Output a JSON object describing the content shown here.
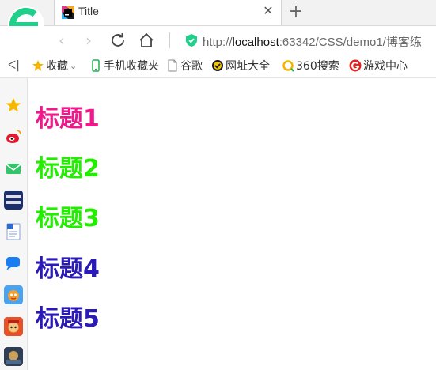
{
  "tab": {
    "title": "Title"
  },
  "address": {
    "scheme": "http://",
    "host": "localhost",
    "rest": ":63342/CSS/demo1/博客练"
  },
  "bookmarks": [
    {
      "label": "收藏",
      "icon": "star-icon"
    },
    {
      "label": "手机收藏夹",
      "icon": "phone-icon"
    },
    {
      "label": "谷歌",
      "icon": "page-icon"
    },
    {
      "label": "网址大全",
      "icon": "globe-icon"
    },
    {
      "label": "360搜索",
      "icon": "search-360-icon"
    },
    {
      "label": "游戏中心",
      "icon": "game-icon"
    }
  ],
  "headings": [
    {
      "text": "标题1",
      "color": "#ee1a8c"
    },
    {
      "text": "标题2",
      "color": "#22ee00"
    },
    {
      "text": "标题3",
      "color": "#22ee00"
    },
    {
      "text": "标题4",
      "color": "#2a1ab8"
    },
    {
      "text": "标题5",
      "color": "#2a1ab8"
    }
  ],
  "colors": {
    "accent_green": "#1fcf8a",
    "link_gray": "#6a6a6a"
  }
}
